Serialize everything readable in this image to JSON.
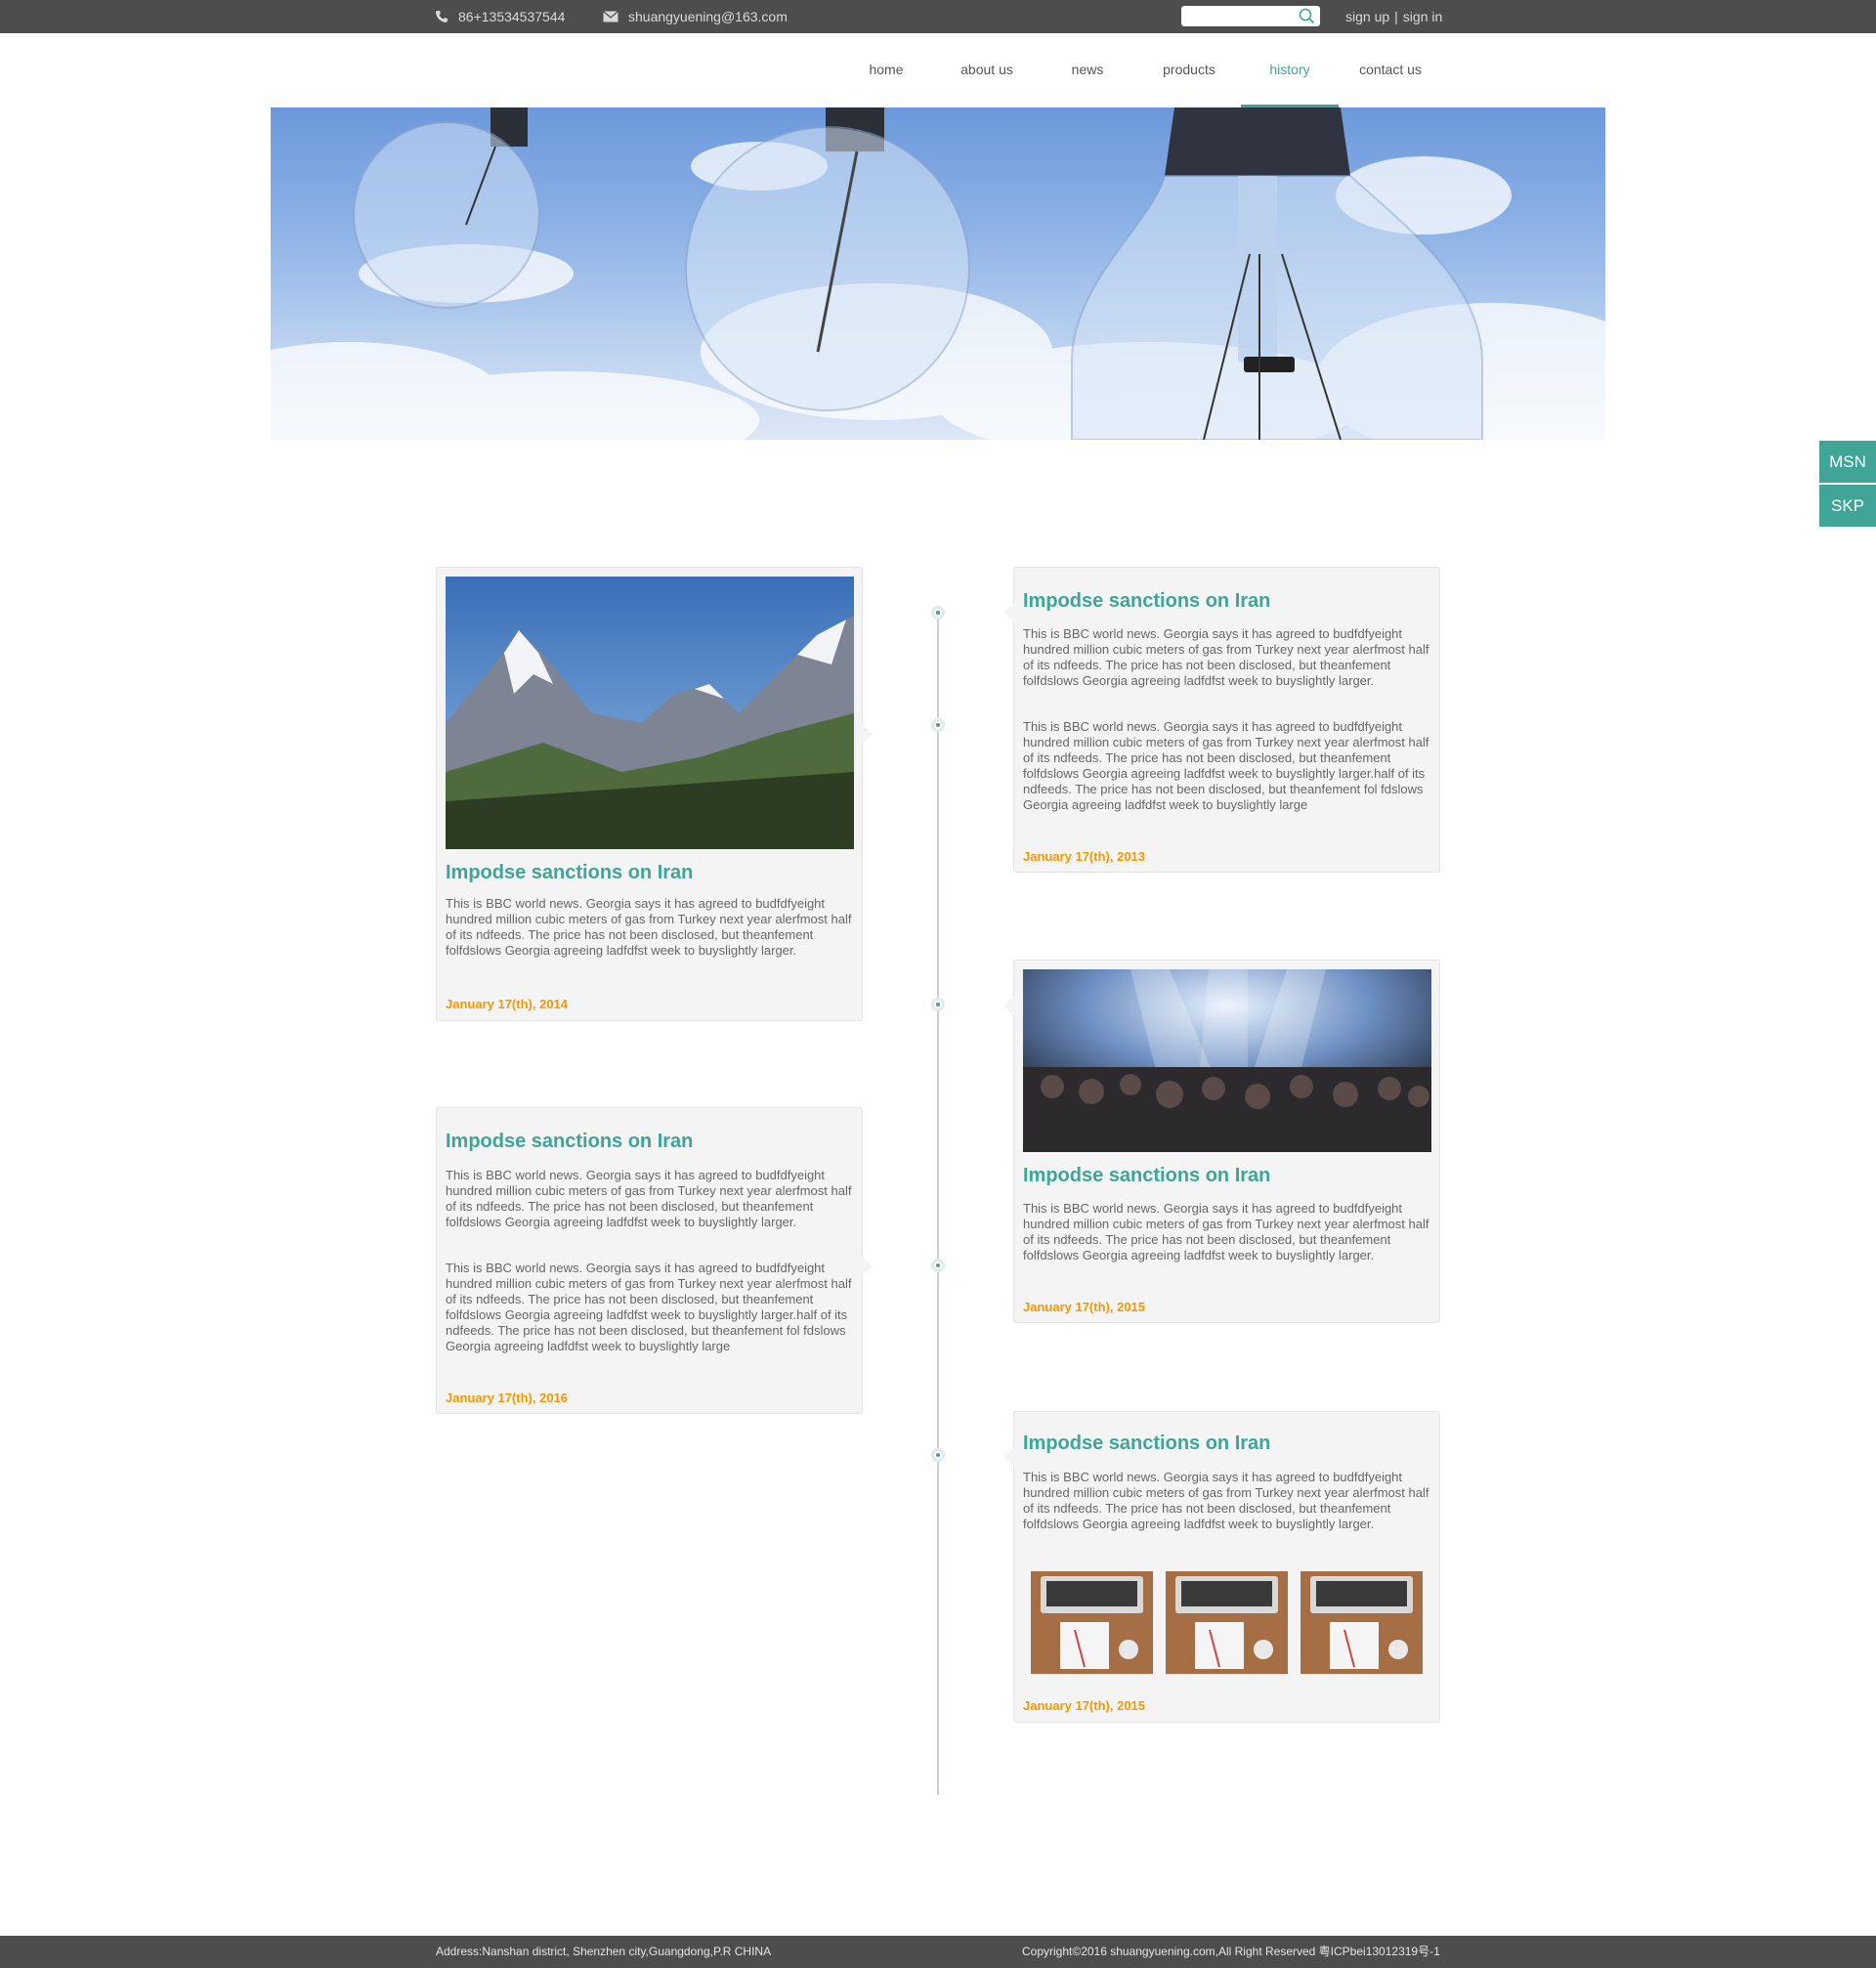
{
  "topbar": {
    "phone": "86+13534537544",
    "email": "shuangyuening@163.com",
    "search_placeholder": "",
    "signup": "sign up",
    "separator": "|",
    "signin": "sign in"
  },
  "nav": {
    "items": [
      "home",
      "about us",
      "news",
      "products",
      "history",
      "contact us"
    ],
    "active": "history"
  },
  "side": {
    "msn": "MSN",
    "skp": "SKP"
  },
  "cards": [
    {
      "title": "Impodse sanctions on Iran",
      "paragraphs": [
        "This is BBC world news. Georgia says it has agreed to budfdfyeight hundred million cubic meters of gas from Turkey next year alerfmost half of its ndfeeds. The price has not been disclosed, but theanfement folfdslows Georgia agreeing ladfdfst week to buyslightly larger."
      ],
      "date": "January 17(th), 2014",
      "image": "mountain-landscape"
    },
    {
      "title": "Impodse sanctions on Iran",
      "paragraphs": [
        "This is BBC world news. Georgia says it has agreed to budfdfyeight hundred million cubic meters of gas from Turkey next year alerfmost half of its ndfeeds. The price has not been disclosed, but theanfement folfdslows Georgia agreeing ladfdfst week to buyslightly larger.",
        "This is BBC world news. Georgia says it has agreed to budfdfyeight hundred million cubic meters of gas from Turkey next year alerfmost half of its ndfeeds. The price has not been disclosed, but theanfement folfdslows Georgia agreeing ladfdfst week to buyslightly larger.half of its ndfeeds. The price has not been disclosed, but theanfement fol fdslows Georgia agreeing ladfdfst week to buyslightly large"
      ],
      "date": "January 17(th), 2013"
    },
    {
      "title": "Impodse sanctions on Iran",
      "paragraphs": [
        "This is BBC world news. Georgia says it has agreed to budfdfyeight hundred million cubic meters of gas from Turkey next year alerfmost half of its ndfeeds. The price has not been disclosed, but theanfement folfdslows Georgia agreeing ladfdfst week to buyslightly larger."
      ],
      "date": "January 17(th), 2015",
      "image": "concert-crowd"
    },
    {
      "title": "Impodse sanctions on Iran",
      "paragraphs": [
        "This is BBC world news. Georgia says it has agreed to budfdfyeight hundred million cubic meters of gas from Turkey next year alerfmost half of its ndfeeds. The price has not been disclosed, but theanfement folfdslows Georgia agreeing ladfdfst week to buyslightly larger.",
        "This is BBC world news. Georgia says it has agreed to budfdfyeight hundred million cubic meters of gas from Turkey next year alerfmost half of its ndfeeds. The price has not been disclosed, but theanfement folfdslows Georgia agreeing ladfdfst week to buyslightly larger.half of its ndfeeds. The price has not been disclosed, but theanfement fol fdslows Georgia agreeing ladfdfst week to buyslightly large"
      ],
      "date": "January 17(th), 2016"
    },
    {
      "title": "Impodse sanctions on Iran",
      "paragraphs": [
        "This is BBC world news. Georgia says it has agreed to budfdfyeight hundred million cubic meters of gas from Turkey next year alerfmost half of its ndfeeds. The price has not been disclosed, but theanfement folfdslows Georgia agreeing ladfdfst week to buyslightly larger."
      ],
      "date": "January 17(th), 2015",
      "thumbnails": [
        "laptop-desk",
        "laptop-desk",
        "laptop-desk"
      ]
    }
  ],
  "footer": {
    "address": "Address:Nanshan district, Shenzhen city,Guangdong,P.R CHINA",
    "copyright": "Copyright©2016 shuangyuening.com,All Right Reserved 粤ICPbei13012319号-1"
  },
  "colors": {
    "accent": "#3ea597",
    "date": "#f39800",
    "bar": "#4d4d4d"
  }
}
